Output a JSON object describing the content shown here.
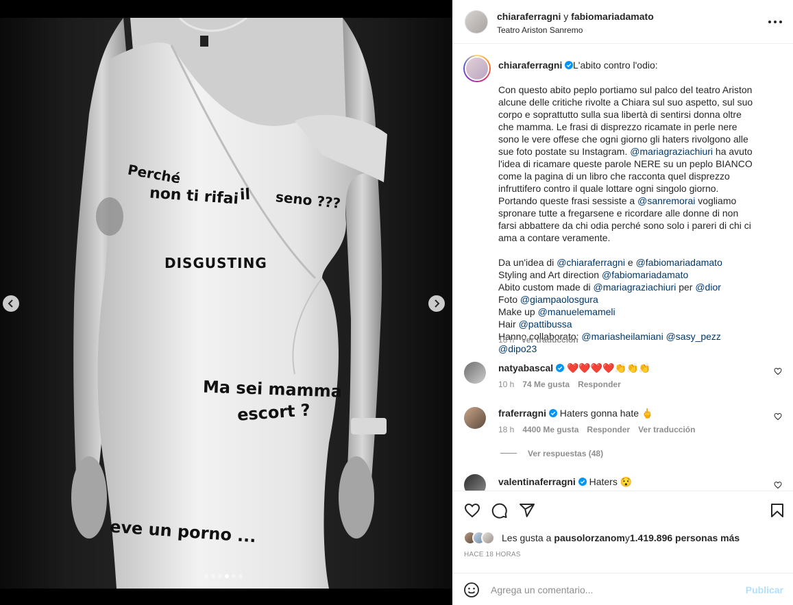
{
  "post": {
    "author": "chiaraferragni",
    "conjunction": " y ",
    "coauthor": "fabiomariadamato",
    "location": "Teatro Ariston Sanremo",
    "more_icon": "more-horizontal-icon"
  },
  "media": {
    "dress_text": {
      "line1": "Perché",
      "line2": "non ti rifai",
      "line3": "il",
      "line4": "seno ???",
      "line5": "DISGUSTING",
      "line6": "Ma sei mamma",
      "line7": "escort ?",
      "line8": "eve un porno ..."
    },
    "carousel_total": 6,
    "carousel_active": 4,
    "prev_icon": "chevron-left-icon",
    "next_icon": "chevron-right-icon"
  },
  "caption": {
    "user": "chiaraferragni",
    "first_line": "L'abito contro l'odio:",
    "p1_a": "Con questo abito peplo portiamo sul palco del teatro Ariston alcune delle critiche rivolte a Chiara sul suo aspetto, sul suo corpo e soprattutto sulla sua libertà di sentirsi donna oltre che mamma. Le frasi di disprezzo ricamate in perle nere sono le vere offese che ogni giorno gli haters rivolgono alle sue foto postate su Instagram. ",
    "p1_mention1": "@mariagraziachiuri",
    "p1_b": " ha avuto l'idea di ricamare queste parole NERE su un peplo BIANCO come la pagina di un libro che racconta quel disprezzo infruttifero contro il quale lottare ogni singolo giorno. Portando queste frasi sessiste a ",
    "p1_mention2": "@sanremorai",
    "p1_c": " vogliamo spronare tutte a fregarsene e ricordare alle donne di non farsi abbattere da chi odia perché sono solo i pareri di chi ci ama a contare veramente.",
    "idea_label": "Da un'idea di ",
    "idea_m1": "@chiaraferragni",
    "idea_and": " e ",
    "idea_m2": "@fabiomariadamato",
    "styling_label": "Styling and Art direction ",
    "styling_m": "@fabiomariadamato",
    "abito_label": "Abito custom made di ",
    "abito_m1": "@mariagraziachiuri",
    "abito_per": " per ",
    "abito_m2": "@dior",
    "foto_label": "Foto ",
    "foto_m": "@giampaolosgura",
    "makeup_label": "Make up ",
    "makeup_m": "@manuelemameli",
    "hair_label": "Hair ",
    "hair_m": "@pattibussa",
    "collab_label": "Hanno collaborato: ",
    "collab_m1": "@mariasheilamiani",
    "collab_m2": "@sasy_pezz",
    "collab_m3": "@dipo23",
    "time": "18 h",
    "translate": "Ver traducción"
  },
  "comments": [
    {
      "user": "natyabascal",
      "text": " ❤️❤️❤️❤️👏👏👏",
      "time": "10 h",
      "likes": "74 Me gusta",
      "reply": "Responder",
      "translate": ""
    },
    {
      "user": "fraferragni",
      "text": " Haters gonna hate 🖕",
      "time": "18 h",
      "likes": "4400 Me gusta",
      "reply": "Responder",
      "translate": "Ver traducción"
    },
    {
      "user": "valentinaferragni",
      "text": " Haters 😯",
      "time": "",
      "likes": "",
      "reply": "",
      "translate": ""
    }
  ],
  "view_replies": "Ver respuestas (48)",
  "actions": {
    "like_icon": "heart-icon",
    "comment_icon": "comment-icon",
    "share_icon": "share-icon",
    "save_icon": "bookmark-icon"
  },
  "likes": {
    "prefix": "Les gusta a ",
    "user": "pausolorzanom",
    "middle": " y ",
    "count": "1.419.896 personas más"
  },
  "timestamp": "HACE 18 HORAS",
  "add_comment": {
    "placeholder": "Agrega un comentario...",
    "post_label": "Publicar",
    "emoji_icon": "smiley-icon"
  },
  "colors": {
    "mention": "#00376b",
    "muted": "#8e8e8e",
    "like_red": "#ed4956",
    "post_disabled": "#b2dffc",
    "verified": "#0095f6"
  }
}
